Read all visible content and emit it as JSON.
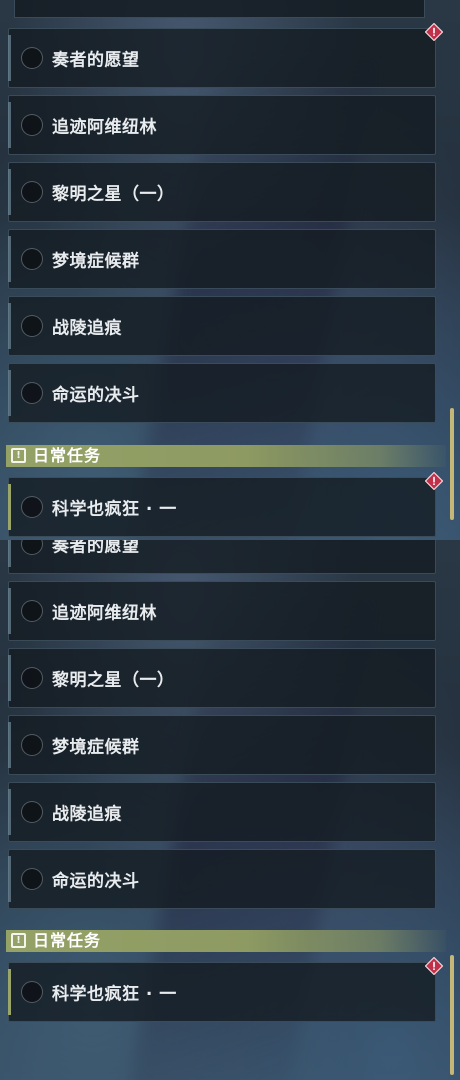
{
  "quests_main": [
    {
      "label": "奏者的愿望",
      "alert": true
    },
    {
      "label": "追迹阿维纽林",
      "alert": false
    },
    {
      "label": "黎明之星（一）",
      "alert": false
    },
    {
      "label": "梦境症候群",
      "alert": false
    },
    {
      "label": "战陵追痕",
      "alert": false
    },
    {
      "label": "命运的决斗",
      "alert": false
    }
  ],
  "daily_section": {
    "icon": "!",
    "title": "日常任务"
  },
  "quests_daily": [
    {
      "label": "科学也疯狂 · 一",
      "alert": true
    }
  ],
  "colors": {
    "section_header": "#94a267",
    "alert": "#c0304a",
    "scrollbar": "#c4b778"
  },
  "icons": [
    "quest-status-circle-icon",
    "alert-diamond-icon",
    "exclamation-box-icon"
  ]
}
